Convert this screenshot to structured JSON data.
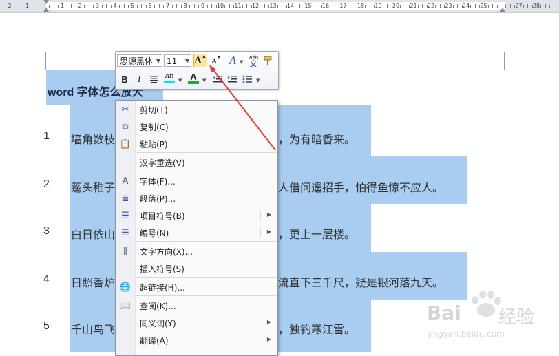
{
  "ruler": {
    "numbers": [
      "2",
      "1",
      "",
      "1",
      "2",
      "3",
      "4",
      "5",
      "6",
      "7",
      "8",
      "9",
      "10",
      "11",
      "12",
      "13",
      "14",
      "15",
      "16",
      "17",
      "18",
      "19",
      "20",
      "21",
      "22",
      "23",
      "24",
      "25",
      "",
      "27",
      "28"
    ]
  },
  "document": {
    "title": "word 字体怎么放大",
    "lines": [
      {
        "num": "1",
        "left": "墙角数枝",
        "right": "，为有暗香来。"
      },
      {
        "num": "2",
        "left": "蓬头稚子",
        "right": "人借问遥招手，怕得鱼惊不应人。"
      },
      {
        "num": "3",
        "left": "白日依山",
        "right": "，更上一层楼。"
      },
      {
        "num": "4",
        "left": "日照香炉",
        "right": "流直下三千尺，疑是银河落九天。"
      },
      {
        "num": "5",
        "left": "千山鸟飞",
        "right": "，独钓寒江雪。"
      }
    ]
  },
  "mini_toolbar": {
    "font_name": "思源黑体",
    "font_size": "11",
    "grow_font_label": "A",
    "shrink_font_label": "A",
    "styles_label": "A",
    "phonetic_label": "wén",
    "phonetic_char": "文",
    "bold": "B",
    "italic": "I",
    "highlight_label": "ab",
    "font_color_label": "A",
    "highlight_color": "#00e5ff",
    "font_color": "#2aa52a",
    "grow_active_color": "#fde6a0"
  },
  "context_menu": {
    "items": [
      {
        "label": "剪切(T)",
        "icon": "scissors-icon",
        "glyph": "✂"
      },
      {
        "label": "复制(C)",
        "icon": "copy-icon",
        "glyph": "⧉"
      },
      {
        "label": "粘贴(P)",
        "icon": "paste-icon",
        "glyph": "📋"
      },
      {
        "label": "汉字重选(V)",
        "icon": "",
        "glyph": ""
      },
      {
        "label": "字体(F)...",
        "icon": "font-icon",
        "glyph": "A"
      },
      {
        "label": "段落(P)...",
        "icon": "paragraph-icon",
        "glyph": "≣"
      },
      {
        "label": "项目符号(B)",
        "icon": "bullets-icon",
        "glyph": "☰",
        "submenu": true
      },
      {
        "label": "编号(N)",
        "icon": "numbering-icon",
        "glyph": "☰",
        "submenu": true
      },
      {
        "label": "文字方向(X)...",
        "icon": "text-direction-icon",
        "glyph": "⫼"
      },
      {
        "label": "插入符号(S)",
        "icon": "",
        "glyph": ""
      },
      {
        "label": "超链接(H)...",
        "icon": "hyperlink-icon",
        "glyph": "🌐"
      },
      {
        "label": "查阅(K)...",
        "icon": "lookup-icon",
        "glyph": "📖"
      },
      {
        "label": "同义词(Y)",
        "icon": "",
        "glyph": "",
        "submenu": true
      },
      {
        "label": "翻译(A)",
        "icon": "",
        "glyph": "",
        "submenu": true
      }
    ]
  },
  "annotation": {
    "color": "#e53935"
  },
  "watermark": {
    "logo": "Bai",
    "brand": "经验",
    "url": "jingyan.baidu.com"
  }
}
